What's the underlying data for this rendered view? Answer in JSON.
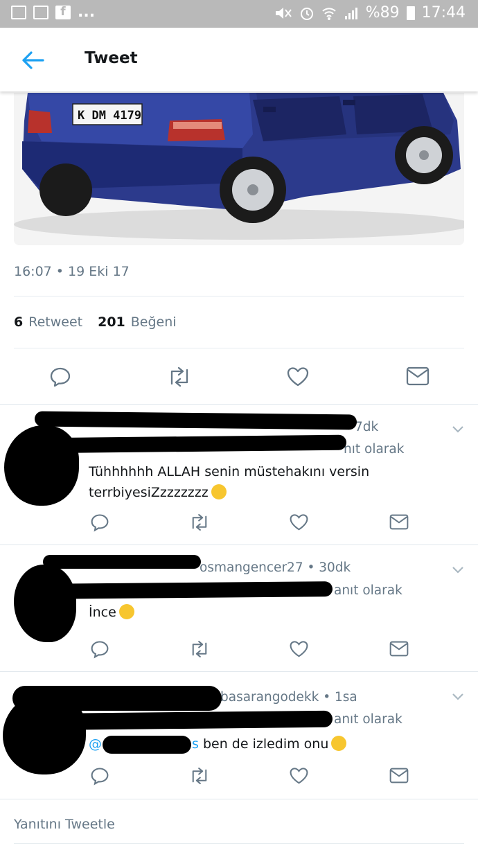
{
  "status_bar": {
    "notifications": "...",
    "battery": "%89",
    "time": "17:44"
  },
  "header": {
    "title": "Tweet"
  },
  "tweet": {
    "plate_text": "K DM 4179",
    "timestamp": "16:07 • 19 Eki 17",
    "retweet_count": "6",
    "retweet_label": "Retweet",
    "like_count": "201",
    "like_label": "Beğeni"
  },
  "replies": [
    {
      "meta": "7dk",
      "reply_to": "nıt olarak",
      "text_line1": "Tühhhhhh ALLAH senin müstehakını versin",
      "text_line2": "terrbiyesiZzzzzzzz",
      "emoji": "laughing-emoji"
    },
    {
      "meta": "osmangencer27 • 30dk",
      "reply_to": "anıt olarak",
      "text_line1": "İnce",
      "emoji": "grinning-emoji"
    },
    {
      "meta": "basarangodekk • 1sa",
      "reply_to": "anıt olarak",
      "mention": "@",
      "mention_tail": "s",
      "text_line1": "ben de izledim onu",
      "emoji": "surprised-emoji"
    }
  ],
  "composer": {
    "placeholder": "Yanıtını Tweetle"
  },
  "colors": {
    "accent": "#1da1f2",
    "secondary_text": "#657786",
    "status_bar": "#b9b9b9"
  }
}
